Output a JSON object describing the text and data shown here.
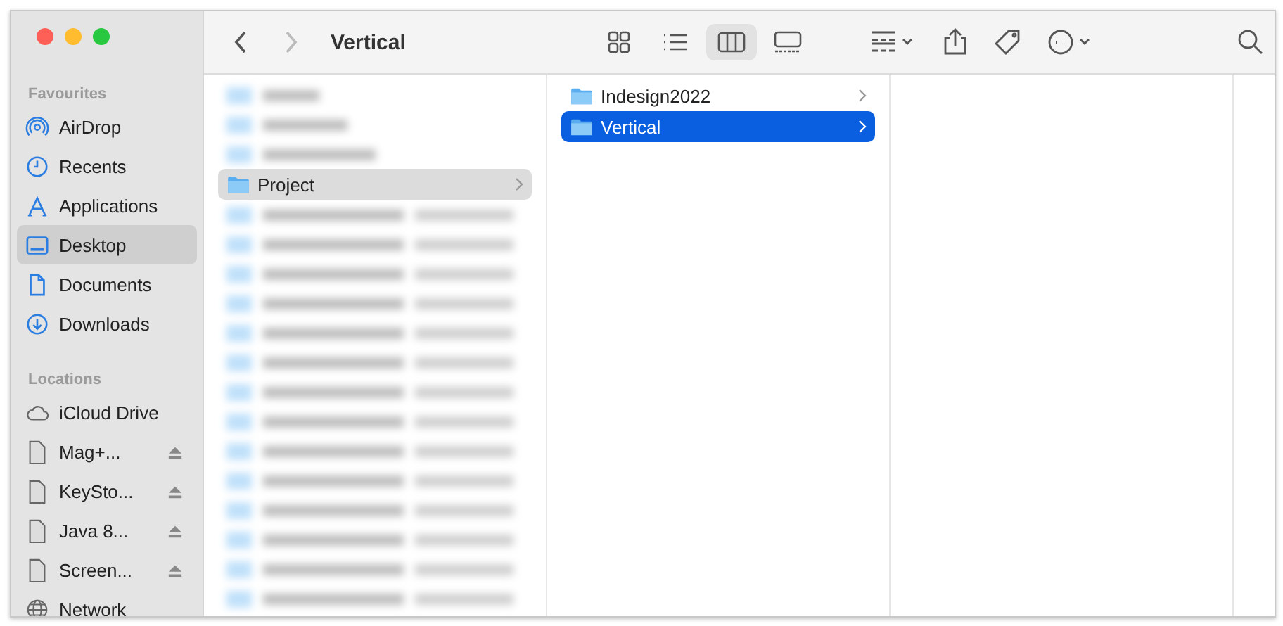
{
  "window": {
    "title": "Vertical"
  },
  "toolbar": {
    "view_modes": [
      {
        "kind": "icons",
        "selected": false
      },
      {
        "kind": "list",
        "selected": false
      },
      {
        "kind": "columns",
        "selected": true
      },
      {
        "kind": "gallery",
        "selected": false
      }
    ],
    "actions": [
      {
        "kind": "group"
      },
      {
        "kind": "share"
      },
      {
        "kind": "tag"
      },
      {
        "kind": "more"
      },
      {
        "kind": "search"
      }
    ]
  },
  "sidebar": {
    "sections": [
      {
        "title": "Favourites",
        "items": [
          {
            "label": "AirDrop",
            "selected": false,
            "eject": false
          },
          {
            "label": "Recents",
            "selected": false,
            "eject": false
          },
          {
            "label": "Applications",
            "selected": false,
            "eject": false
          },
          {
            "label": "Desktop",
            "selected": true,
            "eject": false
          },
          {
            "label": "Documents",
            "selected": false,
            "eject": false
          },
          {
            "label": "Downloads",
            "selected": false,
            "eject": false
          }
        ]
      },
      {
        "title": "Locations",
        "items": [
          {
            "label": "iCloud Drive",
            "selected": false,
            "eject": false
          },
          {
            "label": "Mag+...",
            "selected": false,
            "eject": true
          },
          {
            "label": "KeySto...",
            "selected": false,
            "eject": true
          },
          {
            "label": "Java 8...",
            "selected": false,
            "eject": true
          },
          {
            "label": "Screen...",
            "selected": false,
            "eject": true
          },
          {
            "label": "Network",
            "selected": false,
            "eject": false
          }
        ]
      }
    ]
  },
  "columns": [
    {
      "items": [
        {
          "kind": "blurred"
        },
        {
          "kind": "blurred"
        },
        {
          "kind": "blurred"
        },
        {
          "kind": "folder",
          "label": "Project",
          "selected": true
        },
        {
          "kind": "blurred"
        },
        {
          "kind": "blurred"
        },
        {
          "kind": "blurred"
        },
        {
          "kind": "blurred"
        },
        {
          "kind": "blurred"
        },
        {
          "kind": "blurred"
        },
        {
          "kind": "blurred"
        },
        {
          "kind": "blurred"
        },
        {
          "kind": "blurred"
        },
        {
          "kind": "blurred"
        },
        {
          "kind": "blurred"
        },
        {
          "kind": "blurred"
        },
        {
          "kind": "blurred"
        },
        {
          "kind": "blurred"
        }
      ]
    },
    {
      "items": [
        {
          "kind": "folder",
          "label": "Indesign2022",
          "selected": false
        },
        {
          "kind": "folder",
          "label": "Vertical",
          "selected": true
        }
      ]
    }
  ]
}
